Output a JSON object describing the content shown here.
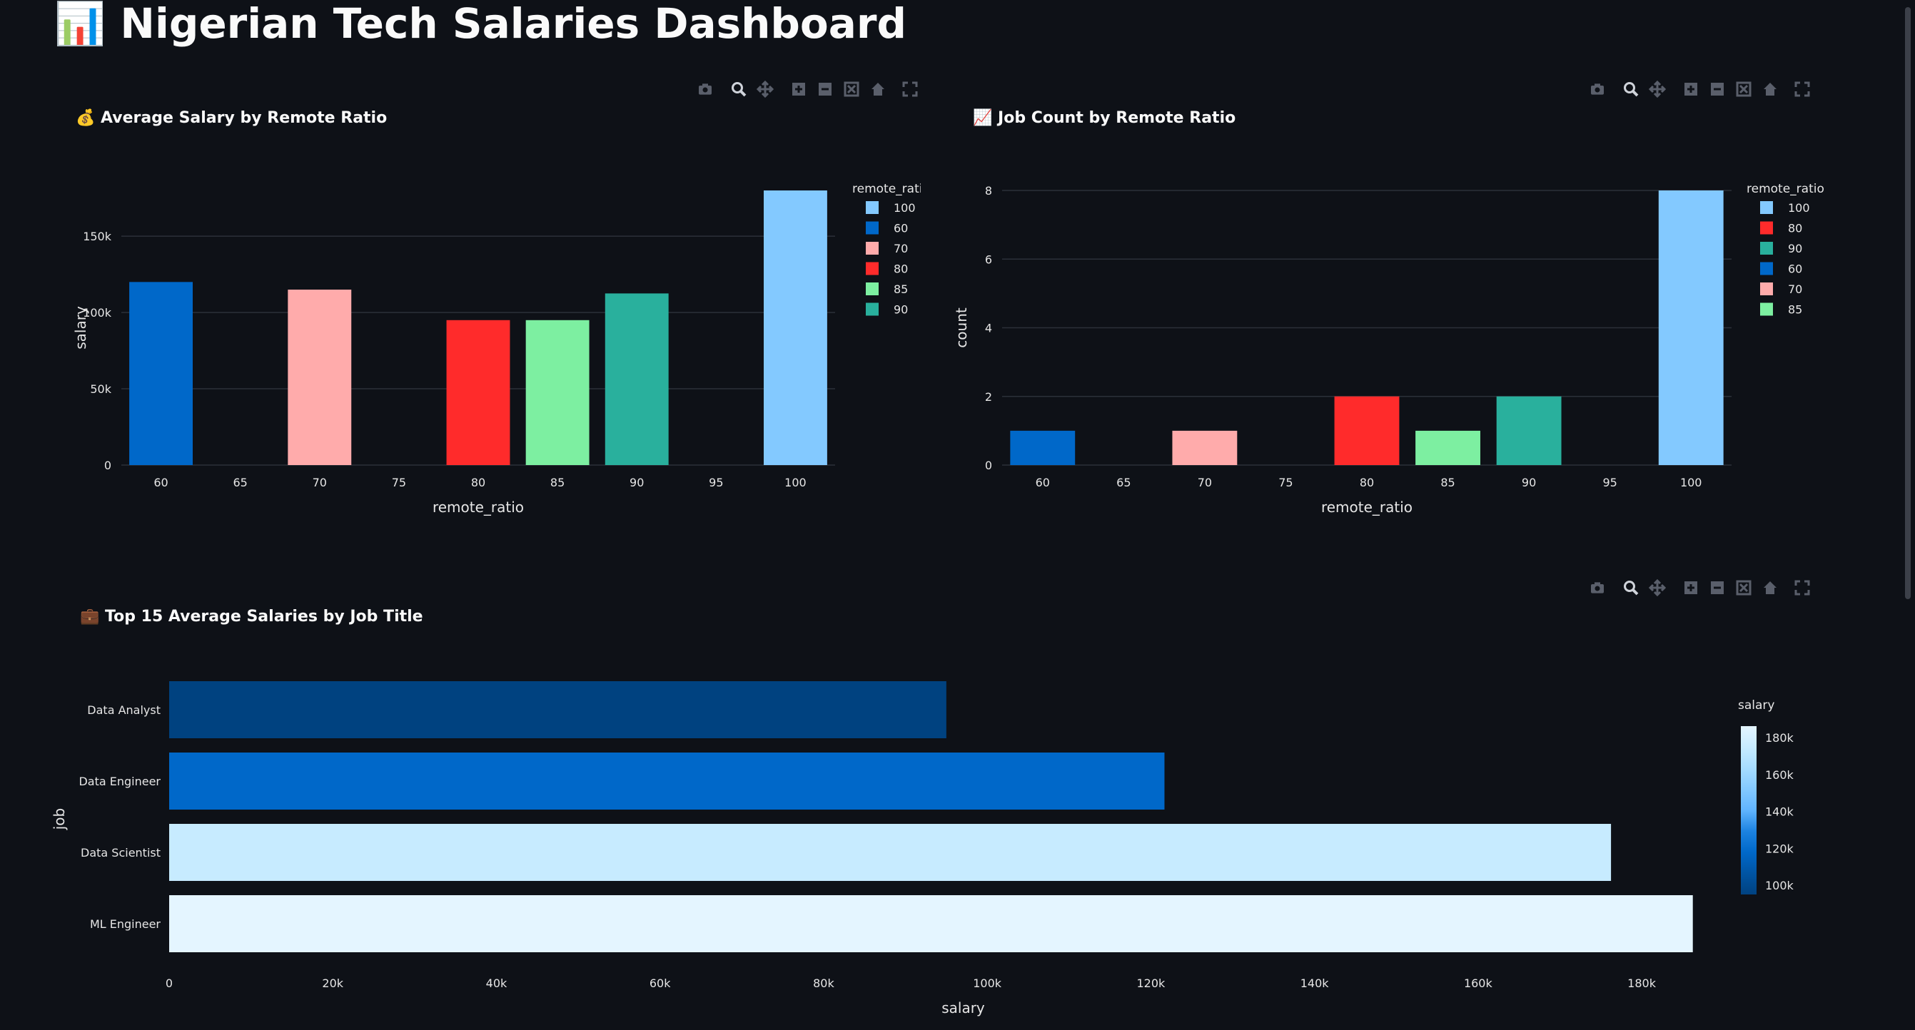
{
  "page": {
    "title": "📊 Nigerian Tech Salaries Dashboard"
  },
  "colors": {
    "background": "#0e1117",
    "grid": "#2b3039",
    "toolbar_icon": "#5a5f6b",
    "remote_ratio": {
      "100": "#83c9ff",
      "60": "#0068c9",
      "70": "#ffabab",
      "80": "#ff2b2b",
      "85": "#7defa1",
      "90": "#29b09d"
    },
    "salary_colorscale": [
      "#004280",
      "#0054a3",
      "#0068c9",
      "#1c83e1",
      "#60b4ff",
      "#83c9ff",
      "#a6dcff",
      "#c7ebff",
      "#e4f5ff"
    ]
  },
  "toolbar_icons": [
    "camera-icon",
    "zoom-icon",
    "pan-icon",
    "zoom-in-icon",
    "zoom-out-icon",
    "autoscale-icon",
    "home-icon",
    "fullscreen-icon"
  ],
  "charts": {
    "salary_by_remote": {
      "title": "💰 Average Salary by Remote Ratio",
      "xlabel": "remote_ratio",
      "ylabel": "salary",
      "y_ticks": [
        "0",
        "50k",
        "100k",
        "150k"
      ],
      "x_ticks": [
        "60",
        "65",
        "70",
        "75",
        "80",
        "85",
        "90",
        "95",
        "100"
      ],
      "legend_title": "remote_ratio",
      "legend": [
        "100",
        "60",
        "70",
        "80",
        "85",
        "90"
      ]
    },
    "count_by_remote": {
      "title": "📈 Job Count by Remote Ratio",
      "xlabel": "remote_ratio",
      "ylabel": "count",
      "y_ticks": [
        "0",
        "2",
        "4",
        "6",
        "8"
      ],
      "x_ticks": [
        "60",
        "65",
        "70",
        "75",
        "80",
        "85",
        "90",
        "95",
        "100"
      ],
      "legend_title": "remote_ratio",
      "legend": [
        "100",
        "80",
        "90",
        "60",
        "70",
        "85"
      ]
    },
    "top_jobs": {
      "title": "💼 Top 15 Average Salaries by Job Title",
      "xlabel": "salary",
      "ylabel": "job",
      "x_ticks": [
        "0",
        "20k",
        "40k",
        "60k",
        "80k",
        "100k",
        "120k",
        "140k",
        "160k",
        "180k"
      ],
      "colorbar_title": "salary",
      "colorbar_ticks": [
        "180k",
        "160k",
        "140k",
        "120k",
        "100k"
      ]
    }
  },
  "chart_data": [
    {
      "type": "bar",
      "title": "💰 Average Salary by Remote Ratio",
      "xlabel": "remote_ratio",
      "ylabel": "salary",
      "x": [
        60,
        70,
        80,
        85,
        90,
        100
      ],
      "values": [
        120000,
        115000,
        95000,
        95000,
        112500,
        180000
      ],
      "xlim": [
        57.5,
        102.5
      ],
      "ylim": [
        0,
        180000
      ],
      "grid": true,
      "legend_placement": "right"
    },
    {
      "type": "bar",
      "title": "📈 Job Count by Remote Ratio",
      "xlabel": "remote_ratio",
      "ylabel": "count",
      "x": [
        60,
        70,
        80,
        85,
        90,
        100
      ],
      "values": [
        1,
        1,
        2,
        1,
        2,
        8
      ],
      "xlim": [
        57.5,
        102.5
      ],
      "ylim": [
        0,
        8
      ],
      "grid": true,
      "legend_placement": "right"
    },
    {
      "type": "bar",
      "orientation": "horizontal",
      "title": "💼 Top 15 Average Salaries by Job Title",
      "xlabel": "salary",
      "ylabel": "job",
      "categories": [
        "Data Analyst",
        "Data Engineer",
        "Data Scientist",
        "ML Engineer"
      ],
      "values": [
        95000,
        121666,
        176250,
        186250
      ],
      "xlim": [
        0,
        195000
      ],
      "colorbar_range": [
        95000,
        186250
      ],
      "legend_placement": "right"
    }
  ]
}
